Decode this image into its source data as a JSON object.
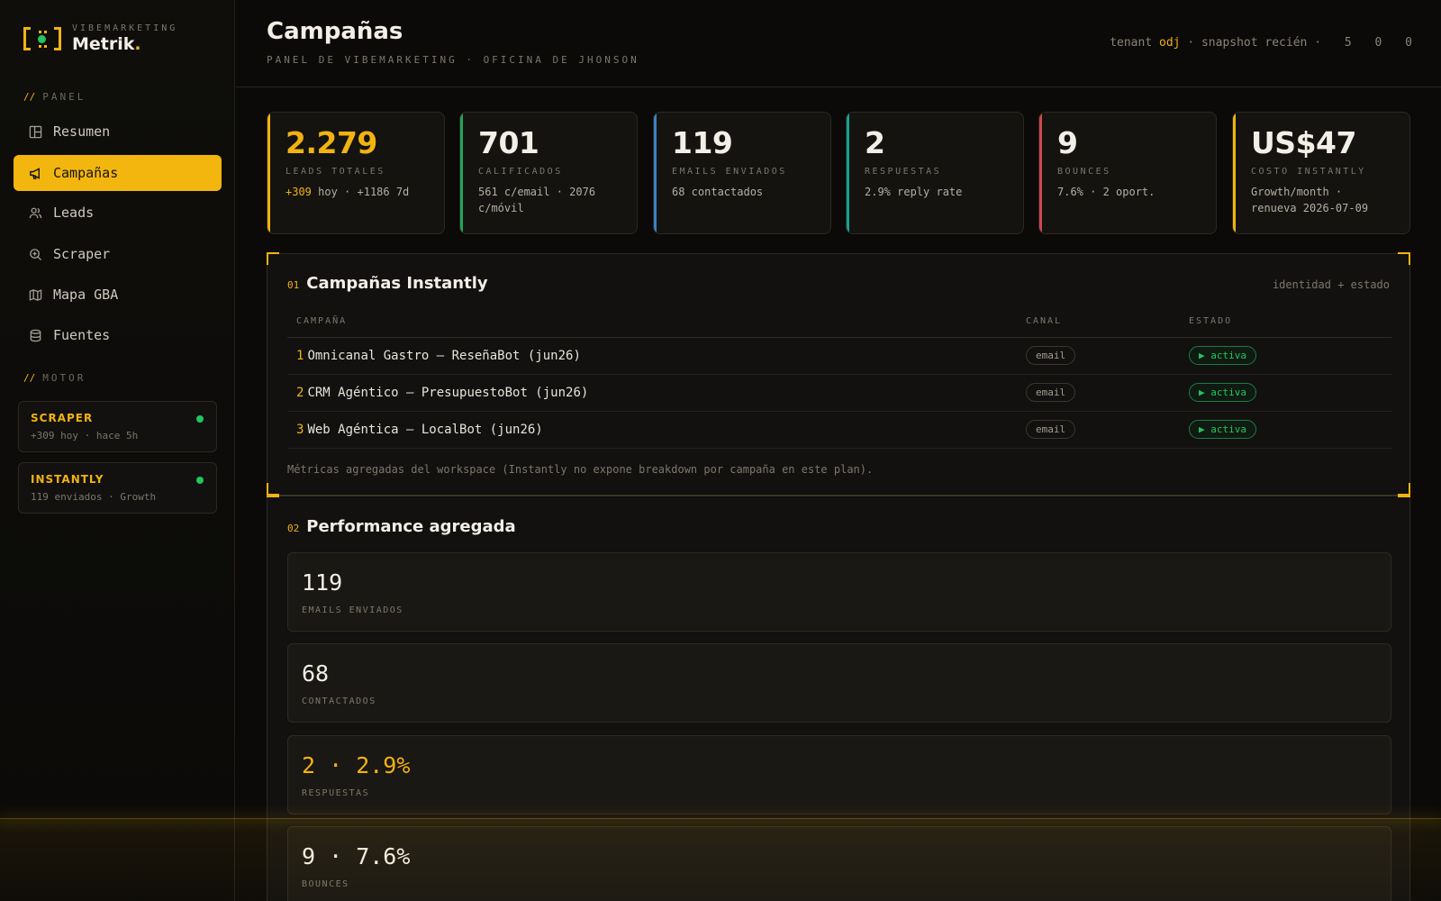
{
  "brand": {
    "subtitle": "VIBEMARKETING",
    "name": "Metrik",
    "dot": "."
  },
  "sidebar": {
    "panel_label": "PANEL",
    "motor_label": "MOTOR",
    "section_mark": "//",
    "items": [
      {
        "label": "Resumen",
        "icon": "layout-icon",
        "active": false
      },
      {
        "label": "Campañas",
        "icon": "megaphone-icon",
        "active": true
      },
      {
        "label": "Leads",
        "icon": "users-icon",
        "active": false
      },
      {
        "label": "Scraper",
        "icon": "search-icon",
        "active": false
      },
      {
        "label": "Mapa GBA",
        "icon": "map-icon",
        "active": false
      },
      {
        "label": "Fuentes",
        "icon": "database-icon",
        "active": false
      }
    ],
    "engines": [
      {
        "title": "SCRAPER",
        "sub": "+309 hoy · hace 5h",
        "status_color": "#22c55e"
      },
      {
        "title": "INSTANTLY",
        "sub": "119 enviados · Growth",
        "status_color": "#22c55e"
      }
    ]
  },
  "header": {
    "title": "Campañas",
    "subtitle": "PANEL DE VIBEMARKETING · OFICINA DE JHONSON",
    "tenant_label": "tenant",
    "tenant_value": "odj",
    "snapshot": "· snapshot recién ·",
    "counts": [
      "5",
      "0",
      "0"
    ]
  },
  "kpis": [
    {
      "value": "2.279",
      "label": "LEADS TOTALES",
      "sub_highlight": "+309",
      "sub": "hoy · +1186 7d",
      "color": "#f2b311"
    },
    {
      "value": "701",
      "label": "CALIFICADOS",
      "sub_highlight": "",
      "sub": "561 c/email · 2076 c/móvil",
      "color": "#22a55a"
    },
    {
      "value": "119",
      "label": "EMAILS ENVIADOS",
      "sub_highlight": "",
      "sub": "68 contactados",
      "color": "#3b82c4"
    },
    {
      "value": "2",
      "label": "RESPUESTAS",
      "sub_highlight": "",
      "sub": "2.9% reply rate",
      "color": "#14a38f"
    },
    {
      "value": "9",
      "label": "BOUNCES",
      "sub_highlight": "",
      "sub": "7.6% · 2 oport.",
      "color": "#d0464e"
    },
    {
      "value": "US$47",
      "label": "COSTO INSTANTLY",
      "sub_highlight": "",
      "sub": "Growth/month · renueva 2026-07-09",
      "color": "#f2b311"
    }
  ],
  "campaigns_panel": {
    "num": "01",
    "title": "Campañas Instantly",
    "note": "identidad + estado",
    "columns": [
      "CAMPAÑA",
      "CANAL",
      "ESTADO"
    ],
    "rows": [
      {
        "idx": "1",
        "name": "Omnicanal Gastro — ReseñaBot (jun26)",
        "channel": "email",
        "status": "▶ activa"
      },
      {
        "idx": "2",
        "name": "CRM Agéntico — PresupuestoBot (jun26)",
        "channel": "email",
        "status": "▶ activa"
      },
      {
        "idx": "3",
        "name": "Web Agéntica — LocalBot (jun26)",
        "channel": "email",
        "status": "▶ activa"
      }
    ],
    "footnote": "Métricas agregadas del workspace (Instantly no expone breakdown por campaña en este plan)."
  },
  "performance_panel": {
    "num": "02",
    "title": "Performance agregada",
    "metrics": [
      {
        "value": "119",
        "label": "EMAILS ENVIADOS",
        "highlight": false
      },
      {
        "value": "68",
        "label": "CONTACTADOS",
        "highlight": false
      },
      {
        "value": "2 · 2.9%",
        "label": "RESPUESTAS",
        "highlight": true
      },
      {
        "value": "9 · 7.6%",
        "label": "BOUNCES",
        "highlight": false
      }
    ]
  }
}
